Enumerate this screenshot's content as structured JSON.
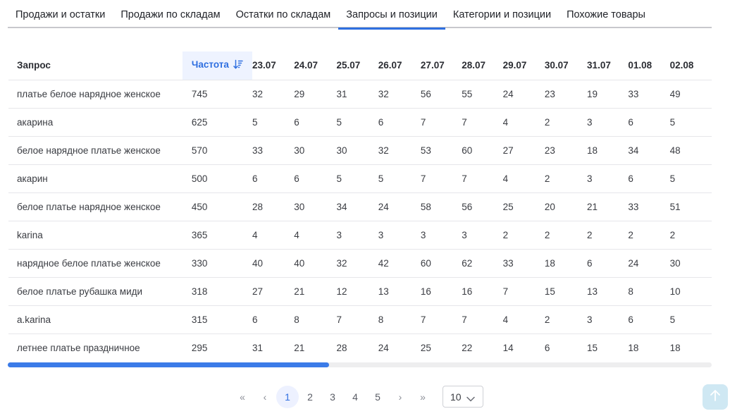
{
  "tabs": [
    {
      "label": "Продажи и остатки",
      "active": false
    },
    {
      "label": "Продажи по складам",
      "active": false
    },
    {
      "label": "Остатки по складам",
      "active": false
    },
    {
      "label": "Запросы и позиции",
      "active": true
    },
    {
      "label": "Категории и позиции",
      "active": false
    },
    {
      "label": "Похожие товары",
      "active": false
    }
  ],
  "table": {
    "query_header": "Запрос",
    "freq_header": "Частота",
    "date_headers": [
      "23.07",
      "24.07",
      "25.07",
      "26.07",
      "27.07",
      "28.07",
      "29.07",
      "30.07",
      "31.07",
      "01.08",
      "02.08"
    ],
    "rows": [
      {
        "query": "платье белое нарядное женское",
        "freq": "745",
        "values": [
          "32",
          "29",
          "31",
          "32",
          "56",
          "55",
          "24",
          "23",
          "19",
          "33",
          "49"
        ]
      },
      {
        "query": "акарина",
        "freq": "625",
        "values": [
          "5",
          "6",
          "5",
          "6",
          "7",
          "7",
          "4",
          "2",
          "3",
          "6",
          "5"
        ]
      },
      {
        "query": "белое нарядное платье женское",
        "freq": "570",
        "values": [
          "33",
          "30",
          "30",
          "32",
          "53",
          "60",
          "27",
          "23",
          "18",
          "34",
          "48"
        ]
      },
      {
        "query": "акарин",
        "freq": "500",
        "values": [
          "6",
          "6",
          "5",
          "5",
          "7",
          "7",
          "4",
          "2",
          "3",
          "6",
          "5"
        ]
      },
      {
        "query": "белое платье нарядное женское",
        "freq": "450",
        "values": [
          "28",
          "30",
          "34",
          "24",
          "58",
          "56",
          "25",
          "20",
          "21",
          "33",
          "51"
        ]
      },
      {
        "query": "karina",
        "freq": "365",
        "values": [
          "4",
          "4",
          "3",
          "3",
          "3",
          "3",
          "2",
          "2",
          "2",
          "2",
          "2"
        ]
      },
      {
        "query": "нарядное белое платье женское",
        "freq": "330",
        "values": [
          "40",
          "40",
          "32",
          "42",
          "60",
          "62",
          "33",
          "18",
          "6",
          "24",
          "30"
        ]
      },
      {
        "query": "белое платье рубашка миди",
        "freq": "318",
        "values": [
          "27",
          "21",
          "12",
          "13",
          "16",
          "16",
          "7",
          "15",
          "13",
          "8",
          "10"
        ]
      },
      {
        "query": "a.karina",
        "freq": "315",
        "values": [
          "6",
          "8",
          "7",
          "8",
          "7",
          "7",
          "4",
          "2",
          "3",
          "6",
          "5"
        ]
      },
      {
        "query": "летнее платье праздничное",
        "freq": "295",
        "values": [
          "31",
          "21",
          "28",
          "24",
          "25",
          "22",
          "14",
          "6",
          "15",
          "18",
          "18"
        ]
      }
    ]
  },
  "pagination": {
    "first": "«",
    "prev": "‹",
    "pages": [
      "1",
      "2",
      "3",
      "4",
      "5"
    ],
    "current": "1",
    "next": "›",
    "last": "»",
    "page_size": "10"
  },
  "colors": {
    "accent": "#2f6fe0",
    "scrollbar": "#3b7be8",
    "to_top": "#cfe8f3"
  },
  "icons": {
    "sort": "sort-desc-icon",
    "dropdown": "chevron-down-icon",
    "to_top": "arrow-up-icon"
  }
}
